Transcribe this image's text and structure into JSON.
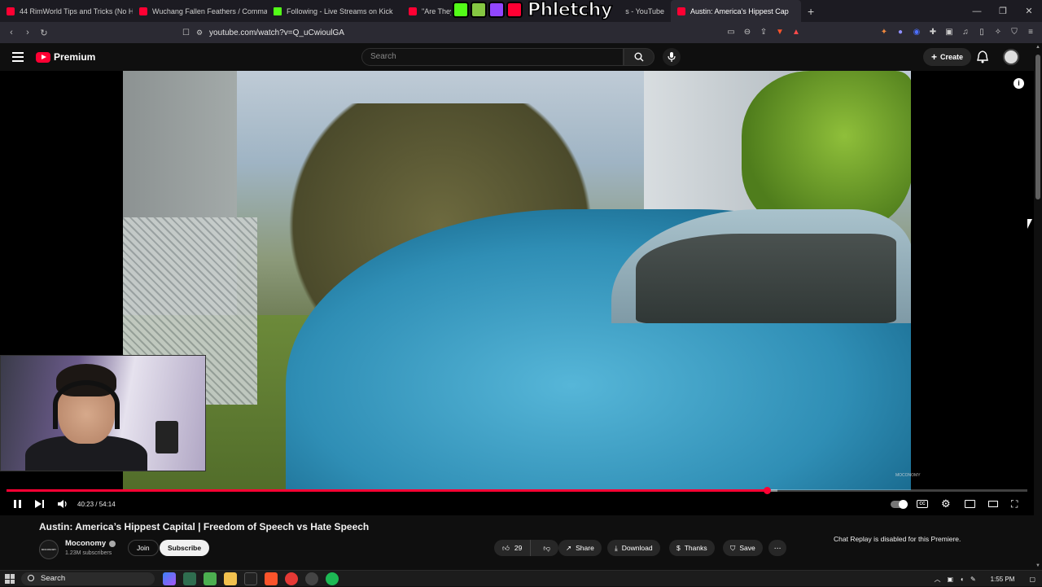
{
  "browser": {
    "tabs": [
      {
        "label": "44 RimWorld Tips and Tricks (No Ha",
        "type": "youtube"
      },
      {
        "label": "Wuchang Fallen Feathers / Comman",
        "type": "youtube"
      },
      {
        "label": "Following - Live Streams on Kick",
        "type": "kick"
      },
      {
        "label": "\"Are They",
        "type": "youtube"
      },
      {
        "label": "s - YouTube",
        "type": "youtube"
      },
      {
        "label": "Austin: America's Hippest Cap",
        "type": "youtube",
        "active": true
      }
    ],
    "overlay_logo_text": "Phletchy",
    "url": "youtube.com/watch?v=Q_uCwioulGA"
  },
  "youtube": {
    "brand_label": "Premium",
    "search_placeholder": "Search",
    "create_label": "Create"
  },
  "player": {
    "current_time": "40:23",
    "duration": "54:14",
    "time_display": "40:23 / 54:14",
    "progress_fraction": 0.745,
    "buffered_fraction": 0.755,
    "cc_label": "CC",
    "watermark": "MOCONOMY"
  },
  "video": {
    "title": "Austin: America’s Hippest Capital | Freedom of Speech vs Hate Speech",
    "channel_name": "Moconomy",
    "channel_avatar_text": "MOCONOMY",
    "subscribers": "1.23M subscribers",
    "join_label": "Join",
    "subscribe_label": "Subscribe",
    "likes": "29",
    "share_label": "Share",
    "download_label": "Download",
    "thanks_label": "Thanks",
    "save_label": "Save",
    "chat_note": "Chat Replay is disabled for this Premiere."
  },
  "taskbar": {
    "search_label": "Search",
    "clock": "1:55 PM"
  },
  "colors": {
    "accent_red": "#ff0033",
    "background": "#0f0f0f",
    "kick_green": "#53fc18"
  }
}
